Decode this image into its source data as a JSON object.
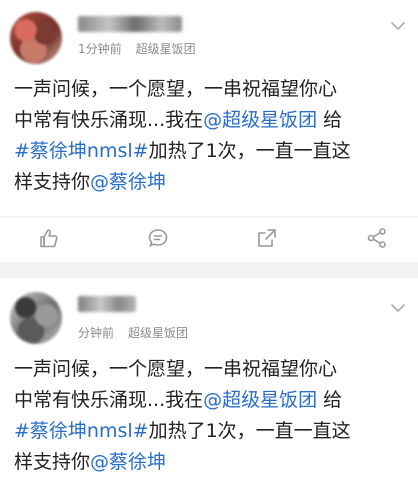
{
  "posts": [
    {
      "meta": {
        "time": "1分钟前",
        "source": "超级星饭团"
      },
      "content": {
        "line1": "一声问候，一个愿望，一串祝福望你心",
        "line2_text": "中常有快乐涌现...我在",
        "line2_link": "@超级星饭团",
        "line2_tail": " 给",
        "line3_link": "#蔡徐坤nmsl#",
        "line3_text": "加热了1次，一直一直这",
        "line4_text": "样支持你",
        "line4_link": "@蔡徐坤"
      },
      "actions": [
        "like-icon",
        "comment-icon",
        "share-icon",
        "more-icon"
      ]
    },
    {
      "meta": {
        "time": "分钟前",
        "source": "超级星饭团"
      },
      "content": {
        "line1": "一声问候，一个愿望，一串祝福望你心",
        "line2_text": "中常有快乐涌现...我在",
        "line2_link": "@超级星饭团",
        "line2_tail": " 给",
        "line3_link": "#蔡徐坤nmsl#",
        "line3_text": "加热了1次，一直一直这",
        "line4_text": "样支持你",
        "line4_link": "@蔡徐坤"
      }
    }
  ],
  "colors": {
    "link": "#2a6ec8",
    "meta": "#8c8c8c",
    "icon": "#9a9a9a"
  }
}
